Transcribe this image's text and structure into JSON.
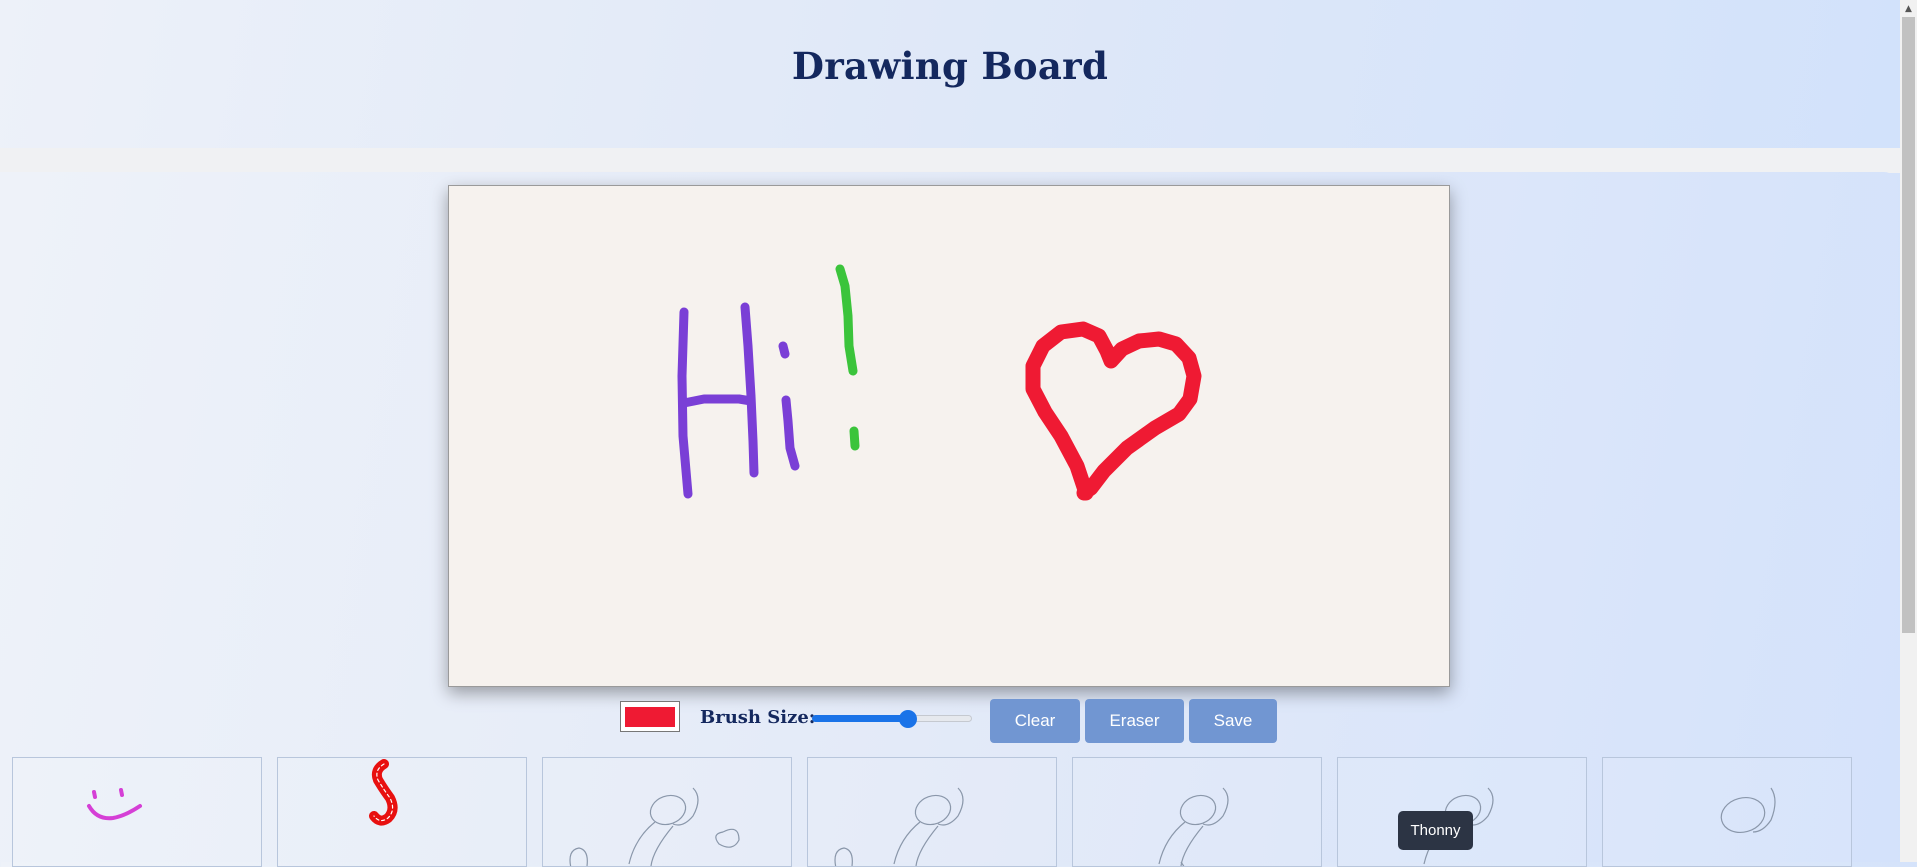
{
  "app": {
    "title": "Drawing Board"
  },
  "controls": {
    "current_color": "#ef1a33",
    "brush_size_label": "Brush Size:",
    "brush_size_fraction": 0.6,
    "clear_label": "Clear",
    "eraser_label": "Eraser",
    "save_label": "Save"
  },
  "canvas": {
    "background": "#f6f2ee",
    "strokes": [
      {
        "name": "letter-h",
        "color": "#7a3fd6"
      },
      {
        "name": "letter-i",
        "color": "#7a3fd6"
      },
      {
        "name": "exclamation",
        "color": "#3bc43b"
      },
      {
        "name": "heart",
        "color": "#ef1a33"
      }
    ]
  },
  "gallery": {
    "tooltip": "Thonny",
    "thumbnails": [
      {
        "name": "smiley",
        "color": "#d53fd6"
      },
      {
        "name": "letter-s",
        "color": "#e81010"
      },
      {
        "name": "sketch",
        "color": "#8a97aa"
      },
      {
        "name": "sketch",
        "color": "#8a97aa"
      },
      {
        "name": "sketch",
        "color": "#8a97aa"
      },
      {
        "name": "sketch",
        "color": "#8a97aa"
      },
      {
        "name": "sketch",
        "color": "#8a97aa"
      }
    ]
  }
}
